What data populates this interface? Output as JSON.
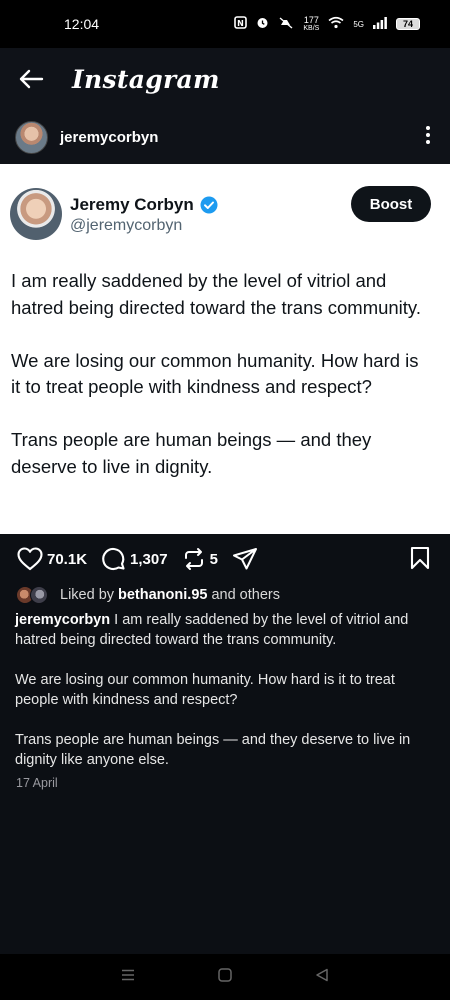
{
  "status_bar": {
    "time": "12:04",
    "net_speed_value": "177",
    "net_speed_unit": "KB/S",
    "network": "5G",
    "battery": "74"
  },
  "header": {
    "title": "Instagram",
    "back_icon": "arrow-left-icon"
  },
  "post": {
    "username": "jeremycorbyn",
    "more_icon": "more-vertical-icon"
  },
  "tweet": {
    "name": "Jeremy Corbyn",
    "handle": "@jeremycorbyn",
    "boost_label": "Boost",
    "paragraphs": [
      "I am really saddened by the level of vitriol and hatred being directed toward the trans community.",
      "We are losing our common humanity. How hard is it to treat people with kindness and respect?",
      "Trans people are human beings — and they deserve to live in dignity."
    ],
    "verified_color": "#1d9bf0"
  },
  "actions": {
    "likes": "70.1K",
    "comments": "1,307",
    "reposts": "5"
  },
  "liked_by": {
    "prefix": "Liked by",
    "user": "bethanoni.95",
    "suffix": "and others"
  },
  "caption": {
    "username": "jeremycorbyn",
    "p1": "I am really saddened by the level of vitriol and hatred being directed toward the trans community.",
    "p2": "We are losing our common humanity. How hard is it to treat people with kindness and respect?",
    "p3": "Trans people are human beings — and they deserve to live in dignity like anyone else."
  },
  "date": "17 April",
  "nav": {
    "recents_icon": "menu-icon",
    "home_icon": "square-icon",
    "back_icon": "triangle-back-icon"
  }
}
